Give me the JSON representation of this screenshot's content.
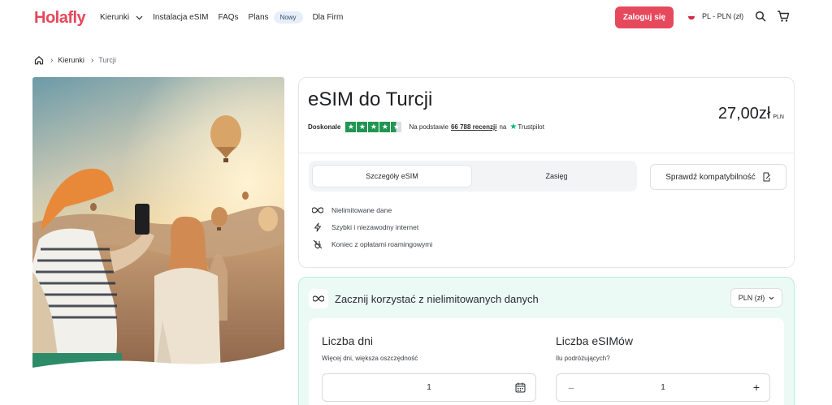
{
  "header": {
    "logo": "Holafly",
    "nav": {
      "destinations": "Kierunki",
      "install": "Instalacja eSIM",
      "faqs": "FAQs",
      "plans": "Plans",
      "new_badge": "Nowy",
      "business": "Dla Firm"
    },
    "login": "Zaloguj się",
    "locale": "PL - PLN (zł)"
  },
  "breadcrumb": {
    "level1": "Kierunki",
    "level2": "Turcji"
  },
  "product": {
    "title": "eSIM do Turcji",
    "price": "27,00zł",
    "currency": "PLN",
    "rating_word": "Doskonale",
    "based_on": "Na podstawie",
    "review_count": "66 788 recenzji",
    "on": "na",
    "trustpilot": "Trustpilot",
    "stars": 4.5,
    "tabs": {
      "details": "Szczegóły eSIM",
      "coverage": "Zasięg"
    },
    "compat_button": "Sprawdź kompatybilność",
    "features": [
      "Nielimitowane dane",
      "Szybki i niezawodny internet",
      "Koniec z opłatami roamingowymi"
    ]
  },
  "plan": {
    "title": "Zacznij korzystać z nielimitowanych danych",
    "currency_select": "PLN (zł)",
    "days": {
      "title": "Liczba dni",
      "subtitle": "Więcej dni, większa oszczędność",
      "value": "1"
    },
    "esims": {
      "title": "Liczba eSIMów",
      "subtitle": "Ilu podróżujących?",
      "value": "1",
      "minus": "−",
      "plus": "+"
    }
  },
  "colors": {
    "brand": "#e6485c",
    "trustpilot_green": "#219653",
    "plan_bg": "#ecfaf6"
  }
}
